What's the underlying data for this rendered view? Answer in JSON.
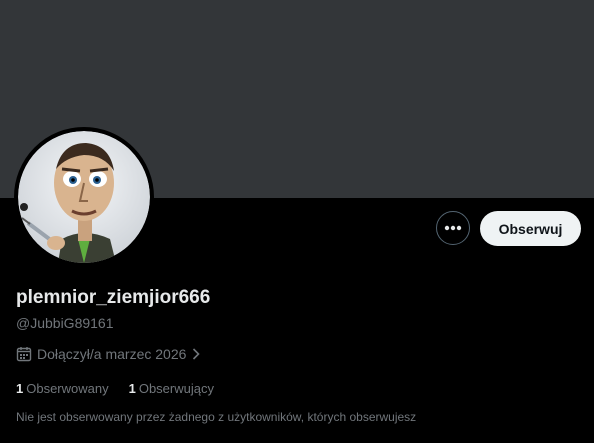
{
  "profile": {
    "display_name": "plemnior_ziemjior666",
    "handle": "@JubbiG89161",
    "joined": "Dołączył/a marzec 2026"
  },
  "actions": {
    "follow_label": "Obserwuj"
  },
  "stats": {
    "following_count": "1",
    "following_label": "Obserwowany",
    "followers_count": "1",
    "followers_label": "Obserwujący"
  },
  "followers_note": "Nie jest obserwowany przez żadnego z użytkowników, których obserwujesz",
  "colors": {
    "banner": "#333639",
    "background": "#000000",
    "button_light": "#eff3f4",
    "muted_text": "#71767b"
  },
  "icons": {
    "more": "more-dots-icon",
    "calendar": "calendar-icon",
    "chevron": "chevron-right-icon"
  }
}
